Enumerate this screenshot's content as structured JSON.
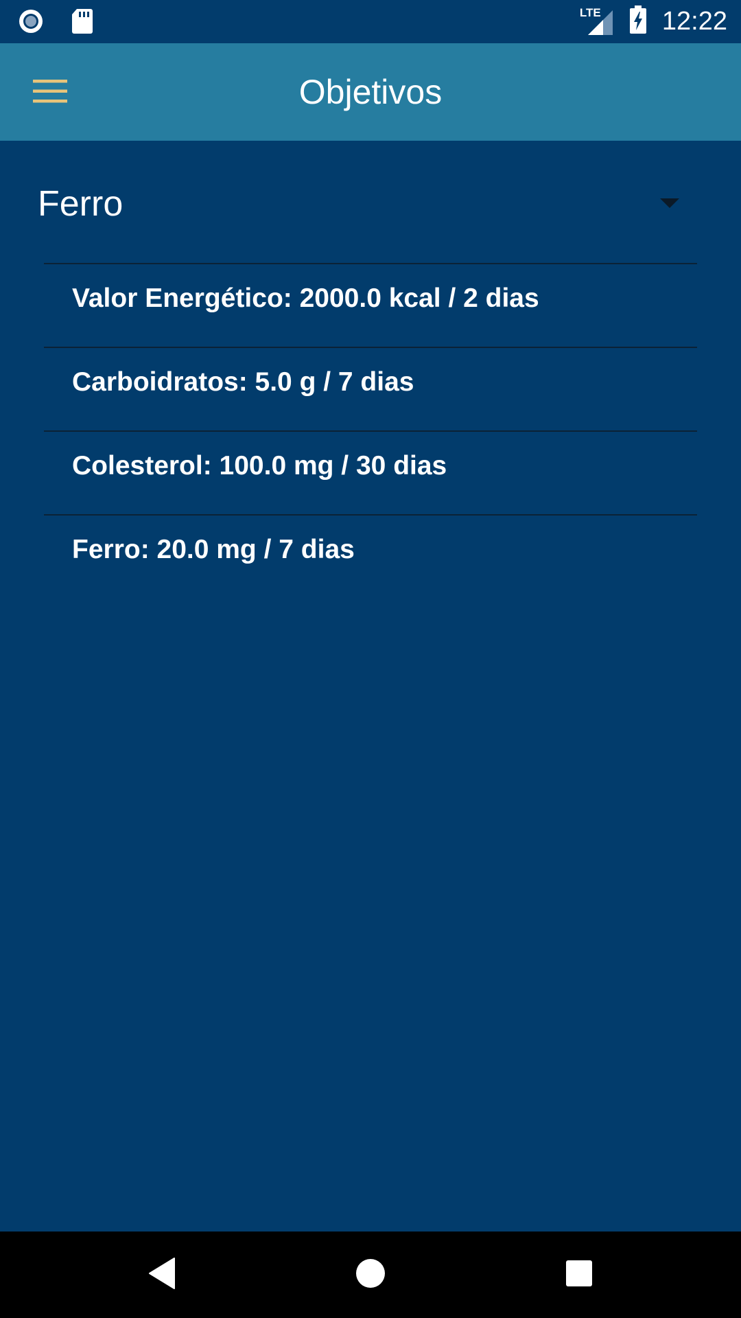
{
  "status_bar": {
    "time": "12:22",
    "network": "LTE"
  },
  "app_bar": {
    "title": "Objetivos",
    "menu_icon": "hamburger-menu-icon",
    "menu_icon_color": "#e8c47a"
  },
  "spinner": {
    "selected": "Ferro"
  },
  "goals": [
    {
      "label": "Valor Energético: 2000.0 kcal / 2 dias"
    },
    {
      "label": "Carboidratos: 5.0 g / 7 dias"
    },
    {
      "label": "Colesterol: 100.0 mg / 30 dias"
    },
    {
      "label": "Ferro: 20.0 mg / 7 dias"
    }
  ],
  "colors": {
    "background": "#023c6c",
    "app_bar": "#267da0",
    "divider": "#0b2236"
  }
}
